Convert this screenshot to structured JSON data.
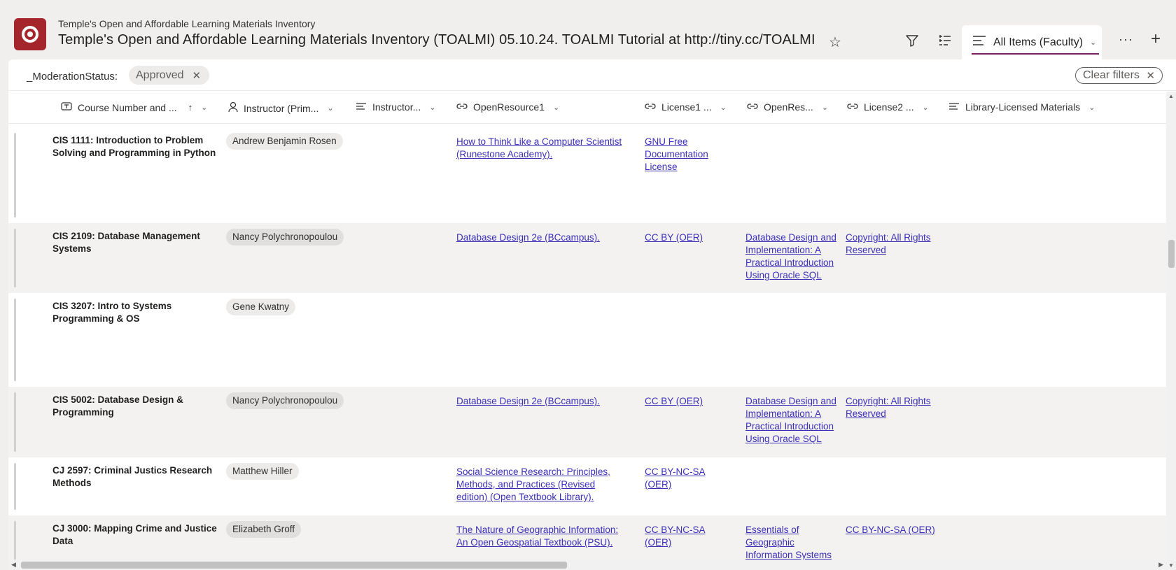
{
  "header": {
    "site_name": "Temple's Open and Affordable Learning Materials Inventory",
    "list_title": "Temple's Open and Affordable Learning Materials Inventory (TOALMI) 05.10.24. TOALMI Tutorial at http://tiny.cc/TOALMI",
    "view_name": "All Items (Faculty)",
    "icons": [
      "star-icon",
      "filter-icon",
      "group-edit-icon",
      "view-list-icon",
      "chevron-down-icon",
      "more-icon",
      "plus-icon"
    ],
    "colors": {
      "brand": "#a4262c",
      "accent": "#7a1f5c",
      "link": "#3b2fb8"
    }
  },
  "filters": {
    "field_label": "_ModerationStatus:",
    "value": "Approved",
    "clear_label": "Clear filters"
  },
  "columns": [
    {
      "label": "Course Number and ...",
      "icon": "text-field-icon",
      "sorted": "ascending"
    },
    {
      "label": "Instructor (Prim...",
      "icon": "person-icon"
    },
    {
      "label": "Instructor...",
      "icon": "lines-icon"
    },
    {
      "label": "OpenResource1",
      "icon": "link-icon"
    },
    {
      "label": "License1 ...",
      "icon": "link-icon"
    },
    {
      "label": "OpenRes...",
      "icon": "link-icon"
    },
    {
      "label": "License2 ...",
      "icon": "link-icon"
    },
    {
      "label": "Library-Licensed Materials",
      "icon": "lines-icon"
    }
  ],
  "rows": [
    {
      "course": "CIS 1111: Introduction to Problem Solving and Programming in Python",
      "instructor": "Andrew Benjamin Rosen",
      "open_resource1": "How to Think Like a Computer Scientist (Runestone Academy).",
      "license1": "GNU Free Documentation License",
      "open_resource2": "",
      "license2": ""
    },
    {
      "course": "CIS 2109: Database Management Systems",
      "instructor": "Nancy Polychronopoulou",
      "open_resource1": "Database Design 2e (BCcampus).",
      "license1": "CC BY (OER)",
      "open_resource2": "Database Design and Implementation: A Practical Introduction Using Oracle SQL",
      "license2": "Copyright: All Rights Reserved"
    },
    {
      "course": "CIS 3207: Intro to Systems Programming & OS",
      "instructor": "Gene Kwatny",
      "open_resource1": "",
      "license1": "",
      "open_resource2": "",
      "license2": ""
    },
    {
      "course": "CIS 5002: Database Design & Programming",
      "instructor": "Nancy Polychronopoulou",
      "open_resource1": "Database Design 2e (BCcampus).",
      "license1": "CC BY (OER)",
      "open_resource2": "Database Design and Implementation: A Practical Introduction Using Oracle SQL",
      "license2": "Copyright: All Rights Reserved"
    },
    {
      "course": "CJ 2597: Criminal Justics Research Methods",
      "instructor": "Matthew Hiller",
      "open_resource1": "Social Science Research: Principles, Methods, and Practices (Revised edition) (Open Textbook Library).",
      "license1": "CC BY-NC-SA (OER)",
      "open_resource2": "",
      "license2": ""
    },
    {
      "course": "CJ 3000: Mapping Crime and Justice Data",
      "instructor": "Elizabeth Groff",
      "open_resource1": "The Nature of Geographic Information: An Open Geospatial Textbook (PSU).",
      "license1": "CC BY-NC-SA (OER)",
      "open_resource2": "Essentials of Geographic Information Systems",
      "license2": "CC BY-NC-SA (OER)"
    }
  ]
}
